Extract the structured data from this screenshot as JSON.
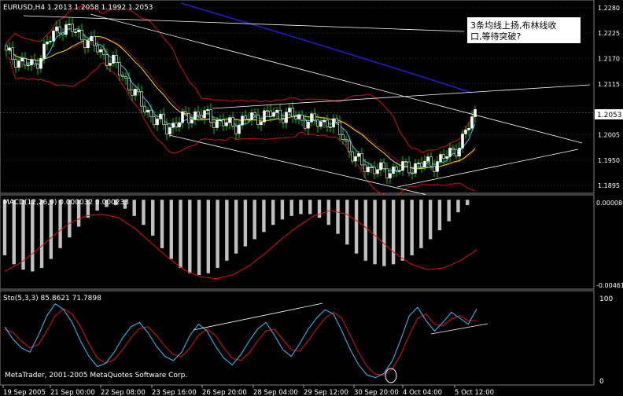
{
  "chart_data": [
    {
      "type": "candlestick",
      "title": "EURUSD,H4 1.2013 1.2058 1.1992 1.2053",
      "symbol": "EURUSD",
      "timeframe": "H4",
      "ohlc_last": [
        1.2013,
        1.2058,
        1.1992,
        1.2053
      ],
      "current_price_label": "1.2053",
      "y_ticks": [
        "1.2280",
        "1.2225",
        "1.2170",
        "1.2115",
        "1.2005",
        "1.1950",
        "1.1895"
      ],
      "ylim": [
        1.1885,
        1.229
      ],
      "annotation": "3条均线上扬,布林线收口,等待突破?",
      "overlays": [
        "bollinger-bands",
        "moving-average-fast",
        "moving-average-mid",
        "moving-average-slow",
        "trendlines"
      ],
      "bars_sample_close": [
        1.218,
        1.2165,
        1.215,
        1.22,
        1.224,
        1.223,
        1.221,
        1.2185,
        1.216,
        1.212,
        1.2075,
        1.204,
        1.202,
        1.2035,
        1.205,
        1.2045,
        1.203,
        1.2025,
        1.204,
        1.2045,
        1.205,
        1.2048,
        1.204,
        1.203,
        1.2035,
        1.201,
        1.195,
        1.1935,
        1.1925,
        1.193,
        1.1935,
        1.194,
        1.1945,
        1.196,
        1.199,
        1.2053
      ]
    },
    {
      "type": "histogram",
      "title": "MACD(12,26,9) 0.000032 0.000233",
      "y_ticks": [
        "0.000084",
        "-0.004616"
      ],
      "ylim": [
        -0.0049,
        0.0001
      ],
      "values": [
        -0.0031,
        -0.0036,
        -0.0039,
        -0.004,
        -0.0038,
        -0.0033,
        -0.0027,
        -0.0021,
        -0.0015,
        -0.001,
        -0.0006,
        -0.0004,
        -0.0003,
        -0.0005,
        -0.0009,
        -0.0014,
        -0.002,
        -0.0027,
        -0.0033,
        -0.0038,
        -0.0041,
        -0.0042,
        -0.0041,
        -0.0038,
        -0.0034,
        -0.003,
        -0.0026,
        -0.0022,
        -0.0018,
        -0.0014,
        -0.0011,
        -0.0009,
        -0.0008,
        -0.0008,
        -0.001,
        -0.0014,
        -0.0019,
        -0.0025,
        -0.003,
        -0.0034,
        -0.0036,
        -0.0037,
        -0.0036,
        -0.0034,
        -0.0031,
        -0.0027,
        -0.0022,
        -0.0017,
        -0.0012,
        -0.0007,
        -0.0003,
        0.0
      ],
      "signal": [
        -0.004,
        -0.0035,
        -0.0028,
        -0.002,
        -0.0013,
        -0.0009,
        -0.0008,
        -0.001,
        -0.0016,
        -0.0024,
        -0.0032,
        -0.0039,
        -0.0043,
        -0.0044,
        -0.0042,
        -0.0037,
        -0.003,
        -0.0022,
        -0.0015,
        -0.0009,
        -0.0006,
        -0.0008,
        -0.0014,
        -0.0022,
        -0.003,
        -0.0036,
        -0.0039,
        -0.0038,
        -0.0034,
        -0.0028
      ]
    },
    {
      "type": "line",
      "title": "Sto(5,3,3) 85.8621 71.7898",
      "y_ticks": [
        "100",
        "0"
      ],
      "ylim": [
        0,
        100
      ],
      "main": [
        65,
        50,
        40,
        35,
        55,
        78,
        92,
        85,
        70,
        48,
        30,
        18,
        22,
        35,
        52,
        65,
        70,
        58,
        42,
        30,
        25,
        35,
        55,
        68,
        60,
        42,
        28,
        20,
        32,
        48,
        62,
        70,
        55,
        38,
        30,
        45,
        62,
        75,
        85,
        80,
        60,
        38,
        20,
        8,
        5,
        10,
        25,
        50,
        78,
        88,
        72,
        60,
        70,
        82,
        75,
        68,
        86
      ],
      "signal": [
        62,
        58,
        48,
        40,
        44,
        60,
        78,
        86,
        80,
        65,
        45,
        28,
        22,
        26,
        38,
        52,
        63,
        65,
        55,
        42,
        32,
        30,
        40,
        55,
        62,
        55,
        40,
        28,
        25,
        34,
        48,
        60,
        62,
        50,
        38,
        36,
        48,
        62,
        75,
        82,
        75,
        55,
        35,
        18,
        9,
        8,
        15,
        32,
        55,
        75,
        80,
        68,
        66,
        74,
        78,
        72,
        72
      ]
    }
  ],
  "x_tick_labels": [
    "19 Sep 2005",
    "21 Sep 00:00",
    "22 Sep 08:00",
    "23 Sep 16:00",
    "26 Sep 20:00",
    "28 Sep 04:00",
    "29 Sep 12:00",
    "30 Sep 20:00",
    "4 Oct 04:00",
    "5 Oct 12:00"
  ],
  "watermark": "MetaTrader, 2001-2005 MetaQuotes Software Corp.",
  "colors": {
    "background": "#000000",
    "up_candle": "#ffffff",
    "down_candle": "#ffffff",
    "bollinger": "#d01010",
    "ma_fast": "#40c0ff",
    "ma_mid": "#e8e040",
    "ma_slow": "#2020c8",
    "macd_bars": "#c0c0c0",
    "macd_signal": "#e01010",
    "sto_main": "#40c0ff",
    "sto_signal": "#e01010",
    "trendline": "#ffffff",
    "grid": "#606060"
  }
}
